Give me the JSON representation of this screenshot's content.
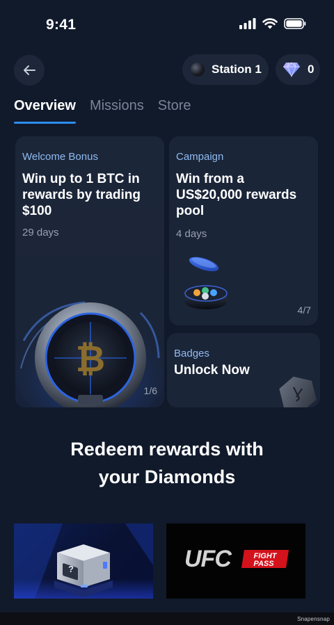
{
  "status_bar": {
    "time": "9:41"
  },
  "header": {
    "station_label": "Station 1",
    "diamond_count": "0"
  },
  "tabs": [
    {
      "label": "Overview",
      "active": true
    },
    {
      "label": "Missions",
      "active": false
    },
    {
      "label": "Store",
      "active": false
    }
  ],
  "cards": {
    "welcome": {
      "tag": "Welcome Bonus",
      "title": "Win up to 1 BTC in rewards by trading $100",
      "days": "29 days",
      "pager": "1/6"
    },
    "campaign": {
      "tag": "Campaign",
      "title": "Win from a US$20,000 rewards pool",
      "days": "4 days",
      "pager": "4/7"
    },
    "badges": {
      "tag": "Badges",
      "title": "Unlock Now"
    }
  },
  "redeem": {
    "title_line1": "Redeem rewards with",
    "title_line2": "your Diamonds"
  },
  "store_items": {
    "ufc_logo_text": "UFC",
    "ufc_fight": "FIGHT",
    "ufc_pass": "PASS",
    "box_label": "?"
  },
  "watermark": "Snapensnap",
  "colors": {
    "background": "#111a2b",
    "card": "#1b2538",
    "accent": "#2d8cf0",
    "tag": "#8fbbf2"
  }
}
